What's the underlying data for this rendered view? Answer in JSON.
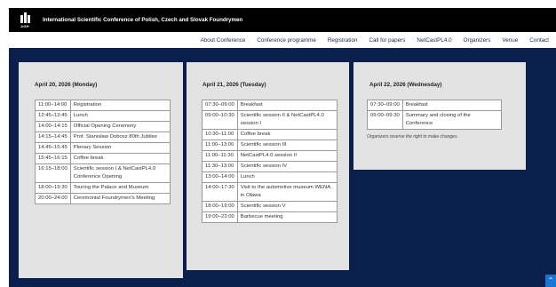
{
  "header": {
    "logo_text": "AGH",
    "site_title": "International Scientific Conference of Polish, Czech and Slovak Foundrymen"
  },
  "nav": [
    {
      "label": "About Conference"
    },
    {
      "label": "Conference programme"
    },
    {
      "label": "Registration"
    },
    {
      "label": "Call for papers"
    },
    {
      "label": "NetCastPL4.0"
    },
    {
      "label": "Organizers"
    },
    {
      "label": "Venue"
    },
    {
      "label": "Contact"
    }
  ],
  "days": [
    {
      "title": "April 20, 2026 (Monday)",
      "rows": [
        {
          "time": "11:00–14:00",
          "event": "Registration"
        },
        {
          "time": "12:45–13:45",
          "event": "Lunch"
        },
        {
          "time": "14:00–14:15",
          "event": "Official Opening Ceremony"
        },
        {
          "time": "14:15–14:45",
          "event": "Prof. Stanisław Dobosz 80th Jubilee"
        },
        {
          "time": "14:45–15:45",
          "event": "Plenary Session"
        },
        {
          "time": "15:45–16:15",
          "event": "Coffee break"
        },
        {
          "time": "16:15–18:00",
          "event": "Scientific session I & NetCastPL4.0 Conference Opening"
        },
        {
          "time": "18:00–19:30",
          "event": "Touring the Palace and Museum"
        },
        {
          "time": "20:00–24:00",
          "event": "Ceremonial Foundrymen's Meeting"
        }
      ]
    },
    {
      "title": "April 21, 2026 (Tuesday)",
      "rows": [
        {
          "time": "07:30–09:00",
          "event": "Breakfast"
        },
        {
          "time": "09:00–10:30",
          "event": "Scientific session II & NetCastPL4.0 session I"
        },
        {
          "time": "10:30–11:00",
          "event": "Coffee break"
        },
        {
          "time": "11:00–13:00",
          "event": "Scientific session III"
        },
        {
          "time": "11:00–11:30",
          "event": "NetCastPL4.0 session II"
        },
        {
          "time": "11:30–13:00",
          "event": "Scientific session IV"
        },
        {
          "time": "13:00–14:00",
          "event": "Lunch"
        },
        {
          "time": "14:00–17:30",
          "event": "Visit to the automotive museum WENA in Oława"
        },
        {
          "time": "18:00–19:00",
          "event": "Scientific session V"
        },
        {
          "time": "19:00–23:00",
          "event": "Barbecue meeting"
        }
      ]
    },
    {
      "title": "April 22, 2026 (Wednesday)",
      "rows": [
        {
          "time": "07:30–09:00",
          "event": "Breakfast"
        },
        {
          "time": "09:00–09:30",
          "event": "Summary and closing of the Conference"
        }
      ],
      "note": "Organizers reserve the right to make changes."
    }
  ],
  "scroll_top_icon": "chevron-up-icon"
}
